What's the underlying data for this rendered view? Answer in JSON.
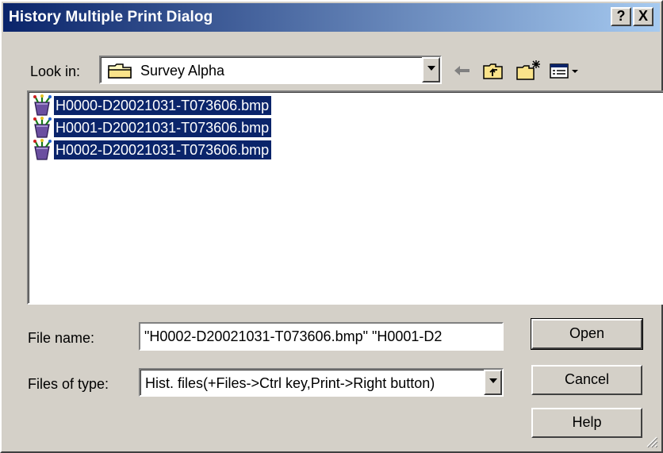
{
  "window": {
    "title": "History Multiple Print Dialog",
    "help_label": "?",
    "close_label": "X"
  },
  "look_in": {
    "label": "Look in:",
    "value": "Survey Alpha"
  },
  "toolbar": {
    "icons": [
      "back-arrow-icon",
      "up-folder-icon",
      "new-folder-icon",
      "view-menu-icon"
    ]
  },
  "files": [
    {
      "name": "H0000-D20021031-T073606.bmp",
      "selected": true
    },
    {
      "name": "H0001-D20021031-T073606.bmp",
      "selected": true
    },
    {
      "name": "H0002-D20021031-T073606.bmp",
      "selected": true
    }
  ],
  "file_name": {
    "label": "File name:",
    "value": "\"H0002-D20021031-T073606.bmp\" \"H0001-D2"
  },
  "file_type": {
    "label": "Files of type:",
    "value": "Hist. files(+Files->Ctrl key,Print->Right button)"
  },
  "buttons": {
    "open": "Open",
    "cancel": "Cancel",
    "help": "Help"
  },
  "colors": {
    "title_start": "#0a246a",
    "title_end": "#a6caf0",
    "selection": "#0a246a",
    "face": "#d4d0c8"
  }
}
